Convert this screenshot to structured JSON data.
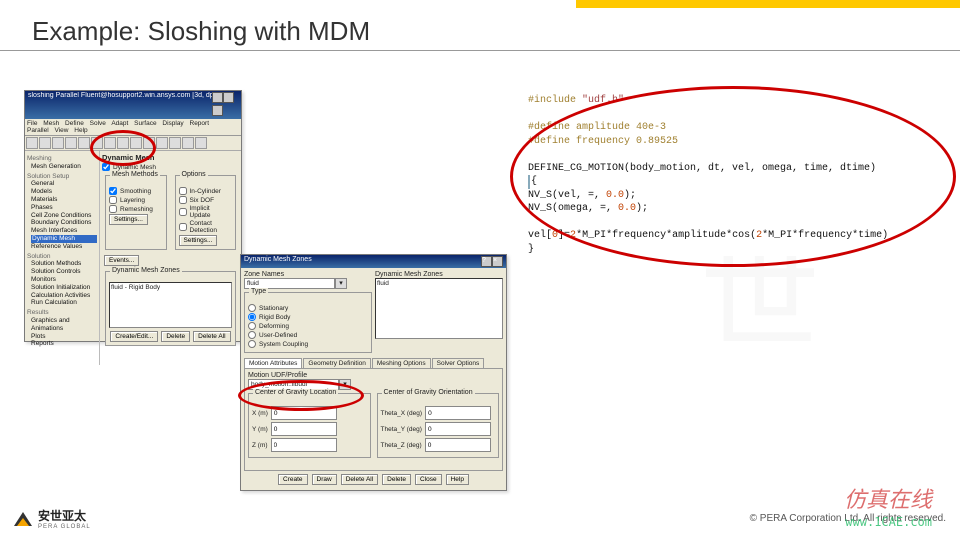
{
  "slide_title": "Example: Sloshing with MDM",
  "fluent_window": {
    "title": "sloshing Parallel Fluent@hosupport2.win.ansys.com [3d, dp, pbns, dynam...",
    "menus": [
      "File",
      "Mesh",
      "Define",
      "Solve",
      "Adapt",
      "Surface",
      "Display",
      "Report",
      "Parallel",
      "View",
      "Help"
    ],
    "tree": {
      "h1": "Meshing",
      "g1": [
        "Mesh Generation"
      ],
      "h2": "Solution Setup",
      "g2": [
        "General",
        "Models",
        "Materials",
        "Phases",
        "Cell Zone Conditions",
        "Boundary Conditions",
        "Mesh Interfaces"
      ],
      "sel": "Dynamic Mesh",
      "g3": [
        "Reference Values"
      ],
      "h3": "Solution",
      "g4": [
        "Solution Methods",
        "Solution Controls",
        "Monitors",
        "Solution Initialization",
        "Calculation Activities",
        "Run Calculation"
      ],
      "h4": "Results",
      "g5": [
        "Graphics and Animations",
        "Plots",
        "Reports"
      ]
    },
    "panel": {
      "title": "Dynamic Mesh",
      "chk_dm": "Dynamic Mesh",
      "grp_methods": "Mesh Methods",
      "m1": "Smoothing",
      "m2": "Layering",
      "m3": "Remeshing",
      "settings_btn": "Settings...",
      "grp_options": "Options",
      "o1": "In-Cylinder",
      "o2": "Six DOF",
      "o3": "Implicit Update",
      "o4": "Contact Detection",
      "events_btn": "Events...",
      "grp_zones": "Dynamic Mesh Zones",
      "zone_item": "fluid - Rigid Body",
      "btns": {
        "ce": "Create/Edit...",
        "del": "Delete",
        "delall": "Delete All"
      }
    }
  },
  "dmz_dialog": {
    "title": "Dynamic Mesh Zones",
    "lbl_zone": "Zone Names",
    "zone_val": "fluid",
    "lbl_dyn": "Dynamic Mesh Zones",
    "dyn_item": "fluid",
    "grp_type": "Type",
    "types": [
      "Stationary",
      "Rigid Body",
      "Deforming",
      "User-Defined",
      "System Coupling"
    ],
    "tabs": [
      "Motion Attributes",
      "Geometry Definition",
      "Meshing Options",
      "Solver Options"
    ],
    "lbl_udf": "Motion UDF/Profile",
    "udf_val": "body_motion::libudf",
    "grp_cg": "Center of Gravity Location",
    "cg_x": "X (m)",
    "cg_y": "Y (m)",
    "cg_z": "Z (m)",
    "grp_or": "Center of Gravity Orientation",
    "or_x": "Theta_X (deg)",
    "or_y": "Theta_Y (deg)",
    "or_z": "Theta_Z (deg)",
    "zero": "0",
    "btns": {
      "create": "Create",
      "draw": "Draw",
      "delall": "Delete All",
      "delete": "Delete",
      "close": "Close",
      "help": "Help"
    }
  },
  "code": {
    "l1a": "#include ",
    "l1b": "\"udf.h\"",
    "l2": "#define amplitude 40e-3",
    "l3": "#define frequency 0.89525",
    "l4": "DEFINE_CG_MOTION(body_motion, dt, vel, omega, time, dtime)",
    "l5": "{",
    "l6a": "   NV_S(vel, =, ",
    "l6b": "0.0",
    "l6c": ");",
    "l7a": "   NV_S(omega, =, ",
    "l7b": "0.0",
    "l7c": ");",
    "l8a": "   vel[",
    "l8b": "0",
    "l8c": "]=",
    "l8d": "2",
    "l8e": "*M_PI*frequency*amplitude*cos(",
    "l8f": "2",
    "l8g": "*M_PI*frequency*time)",
    "l9": "}"
  },
  "footer": {
    "brand_cn": "安世亚太",
    "brand_en": "PERA  GLOBAL",
    "copyright": "©  PERA Corporation Ltd. All rights reserved.",
    "wm_cn": "仿真在线",
    "wm_url": "www.1CAE.com"
  }
}
